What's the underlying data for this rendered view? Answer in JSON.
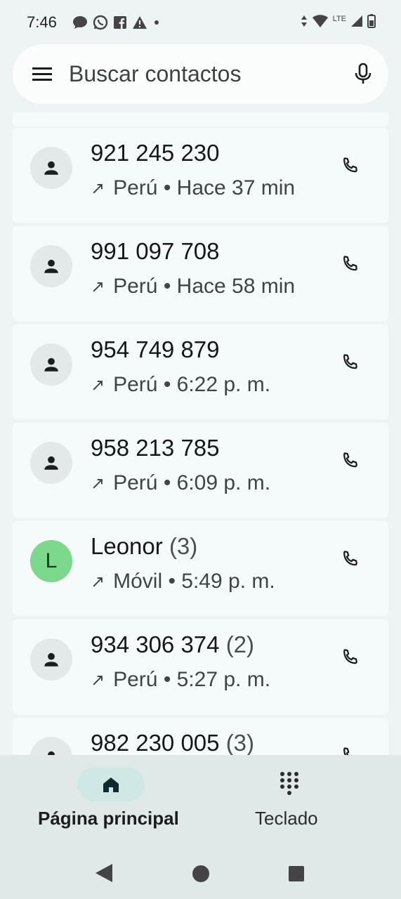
{
  "status_bar": {
    "time": "7:46",
    "network_label": "LTE",
    "left_icons": [
      "chat-bubble-icon",
      "whatsapp-icon",
      "facebook-icon",
      "warning-icon",
      "dot-icon"
    ],
    "right_icons": [
      "data-arrows-icon",
      "wifi-icon",
      "signal-icon",
      "battery-icon"
    ]
  },
  "search": {
    "placeholder": "Buscar contactos"
  },
  "calls": [
    {
      "name": "921 245 230",
      "count": "",
      "detail": "Perú • Hace 37 min",
      "avatar": "person"
    },
    {
      "name": "991 097 708",
      "count": "",
      "detail": "Perú • Hace 58 min",
      "avatar": "person"
    },
    {
      "name": "954 749 879",
      "count": "",
      "detail": "Perú • 6:22 p. m.",
      "avatar": "person"
    },
    {
      "name": "958 213 785",
      "count": "",
      "detail": "Perú • 6:09 p. m.",
      "avatar": "person"
    },
    {
      "name": "Leonor",
      "count": "(3)",
      "detail": "Móvil • 5:49 p. m.",
      "avatar": "L"
    },
    {
      "name": "934 306 374",
      "count": "(2)",
      "detail": "Perú • 5:27 p. m.",
      "avatar": "person"
    },
    {
      "name": "982 230 005",
      "count": "(3)",
      "detail": "",
      "avatar": "person"
    }
  ],
  "bottom_nav": {
    "home_label": "Página principal",
    "keypad_label": "Teclado"
  },
  "colors": {
    "background": "#eef3f3",
    "card": "#f5fafa",
    "avatar_letter_bg": "#7cd88a",
    "active_pill": "#cfe8e6"
  }
}
